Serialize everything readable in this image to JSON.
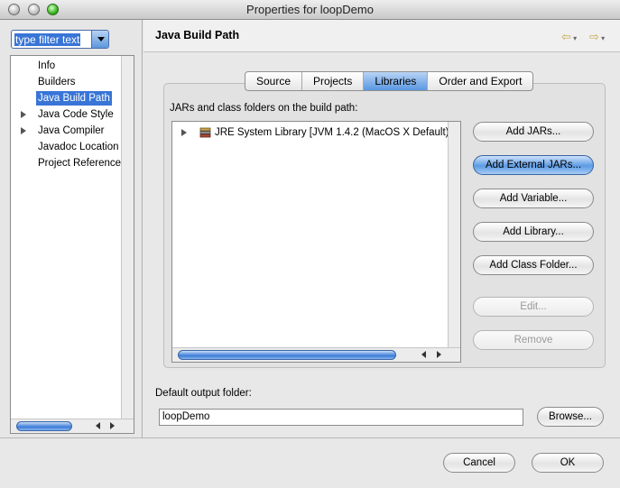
{
  "window": {
    "title": "Properties for loopDemo"
  },
  "filter": {
    "value": "type filter text"
  },
  "tree": {
    "items": [
      {
        "label": "Info",
        "expandable": false,
        "selected": false
      },
      {
        "label": "Builders",
        "expandable": false,
        "selected": false
      },
      {
        "label": "Java Build Path",
        "expandable": false,
        "selected": true
      },
      {
        "label": "Java Code Style",
        "expandable": true,
        "selected": false
      },
      {
        "label": "Java Compiler",
        "expandable": true,
        "selected": false
      },
      {
        "label": "Javadoc Location",
        "expandable": false,
        "selected": false
      },
      {
        "label": "Project Reference",
        "expandable": false,
        "selected": false
      }
    ]
  },
  "page": {
    "title": "Java Build Path"
  },
  "tabs": [
    "Source",
    "Projects",
    "Libraries",
    "Order and Export"
  ],
  "active_tab": "Libraries",
  "libraries": {
    "label": "JARs and class folders on the build path:",
    "entries": [
      "JRE System Library [JVM 1.4.2 (MacOS X Default)]"
    ]
  },
  "buttons": {
    "add_jars": "Add JARs...",
    "add_external_jars": "Add External JARs...",
    "add_variable": "Add Variable...",
    "add_library": "Add Library...",
    "add_class_folder": "Add Class Folder...",
    "edit": "Edit...",
    "remove": "Remove",
    "browse": "Browse...",
    "cancel": "Cancel",
    "ok": "OK"
  },
  "output": {
    "label": "Default output folder:",
    "value": "loopDemo"
  },
  "colors": {
    "selection": "#3875d7",
    "aqua_button": "#5c9be4"
  },
  "icons": [
    "back-arrow-icon",
    "forward-arrow-icon",
    "jar-library-icon",
    "disclosure-triangle-icon"
  ]
}
